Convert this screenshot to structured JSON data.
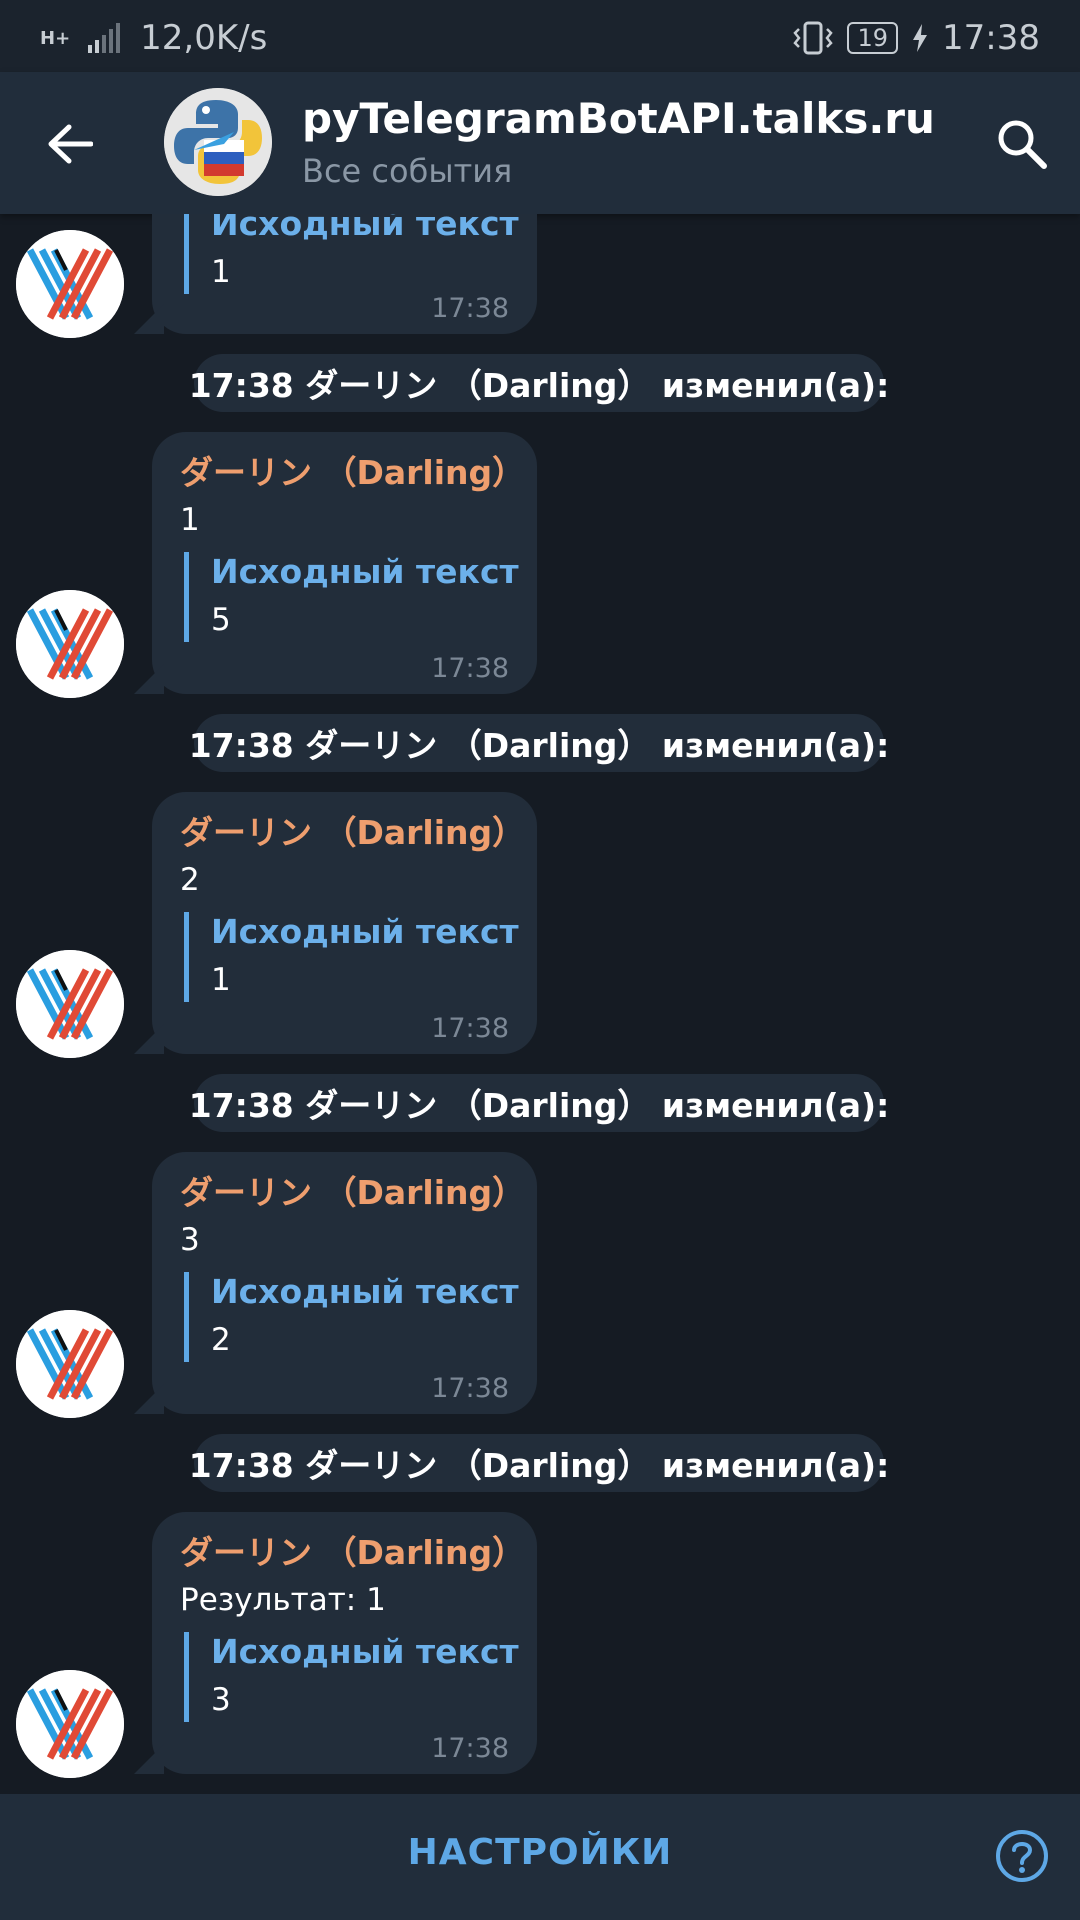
{
  "status_bar": {
    "network_type": "H+",
    "speed": "12,0K/s",
    "battery_level": "19",
    "time": "17:38"
  },
  "header": {
    "title": "pyTelegramBotAPI.talks.ru",
    "subtitle": "Все события"
  },
  "messages": [
    {
      "sender": "",
      "text": "",
      "quote_title": "Исходный текст",
      "quote_text": "1",
      "time": "17:38"
    },
    {
      "service": "17:38 ダーリン （Darling） изменил(а):",
      "sender": "ダーリン （Darling）",
      "text": "1",
      "quote_title": "Исходный текст",
      "quote_text": "5",
      "time": "17:38"
    },
    {
      "service": "17:38 ダーリン （Darling） изменил(а):",
      "sender": "ダーリン （Darling）",
      "text": "2",
      "quote_title": "Исходный текст",
      "quote_text": "1",
      "time": "17:38"
    },
    {
      "service": "17:38 ダーリン （Darling） изменил(а):",
      "sender": "ダーリン （Darling）",
      "text": "3",
      "quote_title": "Исходный текст",
      "quote_text": "2",
      "time": "17:38"
    },
    {
      "service": "17:38 ダーリン （Darling） изменил(а):",
      "sender": "ダーリン （Darling）",
      "text": "Результат: 1",
      "quote_title": "Исходный текст",
      "quote_text": "3",
      "time": "17:38"
    }
  ],
  "bottom_bar": {
    "settings_label": "НАСТРОЙКИ"
  },
  "icons": {
    "back": "arrow-back-icon",
    "search": "search-icon",
    "help": "help-circle-icon",
    "vibrate": "vibrate-icon",
    "signal": "signal-icon",
    "charging": "charging-icon"
  },
  "colors": {
    "background": "#151b23",
    "header": "#212d3b",
    "bubble": "#222d3a",
    "sender_name": "#ee9e6e",
    "quote_accent": "#5ea8e6",
    "time_text": "#7c8896"
  }
}
